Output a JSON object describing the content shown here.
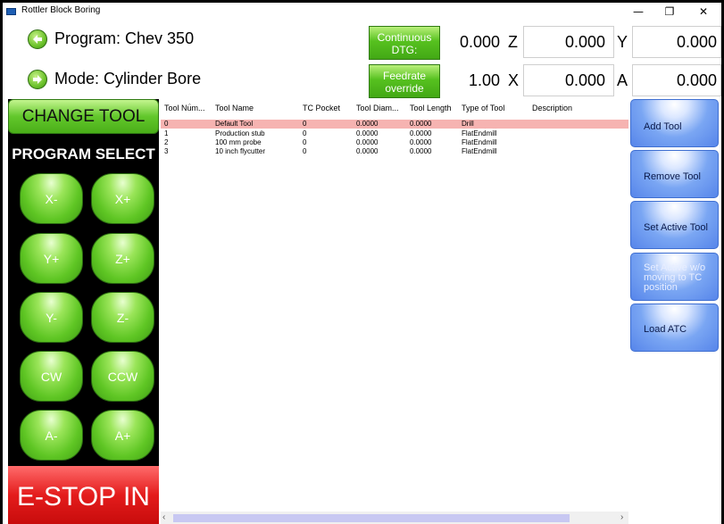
{
  "window": {
    "title": "Rottler Block Boring",
    "controls": {
      "minimize": "—",
      "restore": "❐",
      "close": "✕"
    }
  },
  "header": {
    "program_label": "Program: Chev 350",
    "mode_label": "Mode: Cylinder Bore",
    "continuous_dtg_label": "Continuous DTG:",
    "feedrate_override_label": "Feedrate override",
    "dtg_value": "0.000",
    "feedrate_value": "1.00",
    "axes": {
      "z": {
        "letter": "Z",
        "value": "0.000"
      },
      "y": {
        "letter": "Y",
        "value": "0.000"
      },
      "x": {
        "letter": "X",
        "value": "0.000"
      },
      "a": {
        "letter": "A",
        "value": "0.000"
      }
    }
  },
  "left_panel": {
    "change_tool_label": "CHANGE TOOL",
    "program_select_label": "PROGRAM SELECT",
    "jog_buttons": [
      {
        "id": "x-minus",
        "label": "X-"
      },
      {
        "id": "x-plus",
        "label": "X+"
      },
      {
        "id": "y-plus",
        "label": "Y+"
      },
      {
        "id": "z-plus",
        "label": "Z+"
      },
      {
        "id": "y-minus",
        "label": "Y-"
      },
      {
        "id": "z-minus",
        "label": "Z-"
      },
      {
        "id": "cw",
        "label": "CW"
      },
      {
        "id": "ccw",
        "label": "CCW"
      },
      {
        "id": "a-minus",
        "label": "A-"
      },
      {
        "id": "a-plus",
        "label": "A+"
      }
    ],
    "estop_label": "E-STOP IN"
  },
  "tool_table": {
    "columns": [
      "Tool Num...",
      "Tool Name",
      "TC Pocket",
      "Tool Diam...",
      "Tool Length",
      "Type of Tool",
      "Description"
    ],
    "rows": [
      {
        "num": "0",
        "name": "Default Tool",
        "pocket": "0",
        "diam": "0.0000",
        "length": "0.0000",
        "type": "Drill",
        "desc": "",
        "selected": true
      },
      {
        "num": "1",
        "name": "Production stub",
        "pocket": "0",
        "diam": "0.0000",
        "length": "0.0000",
        "type": "FlatEndmill",
        "desc": "",
        "selected": false
      },
      {
        "num": "2",
        "name": "100 mm probe",
        "pocket": "0",
        "diam": "0.0000",
        "length": "0.0000",
        "type": "FlatEndmill",
        "desc": "",
        "selected": false
      },
      {
        "num": "3",
        "name": "10 inch flycutter",
        "pocket": "0",
        "diam": "0.0000",
        "length": "0.0000",
        "type": "FlatEndmill",
        "desc": "",
        "selected": false
      }
    ],
    "selected_color": "#f6b3b1"
  },
  "right_panel": {
    "buttons": [
      {
        "id": "add-tool",
        "label": "Add Tool",
        "enabled": true
      },
      {
        "id": "remove-tool",
        "label": "Remove Tool",
        "enabled": true
      },
      {
        "id": "set-active-tool",
        "label": "Set Active Tool",
        "enabled": true
      },
      {
        "id": "set-active-wo-moving",
        "label": "Set Active w/o moving to TC position",
        "enabled": false
      },
      {
        "id": "load-atc",
        "label": "Load ATC",
        "enabled": true
      }
    ]
  },
  "colors": {
    "accent_green": "#5fc624",
    "estop_red": "#e41c1c",
    "action_blue": "#5685ea"
  }
}
